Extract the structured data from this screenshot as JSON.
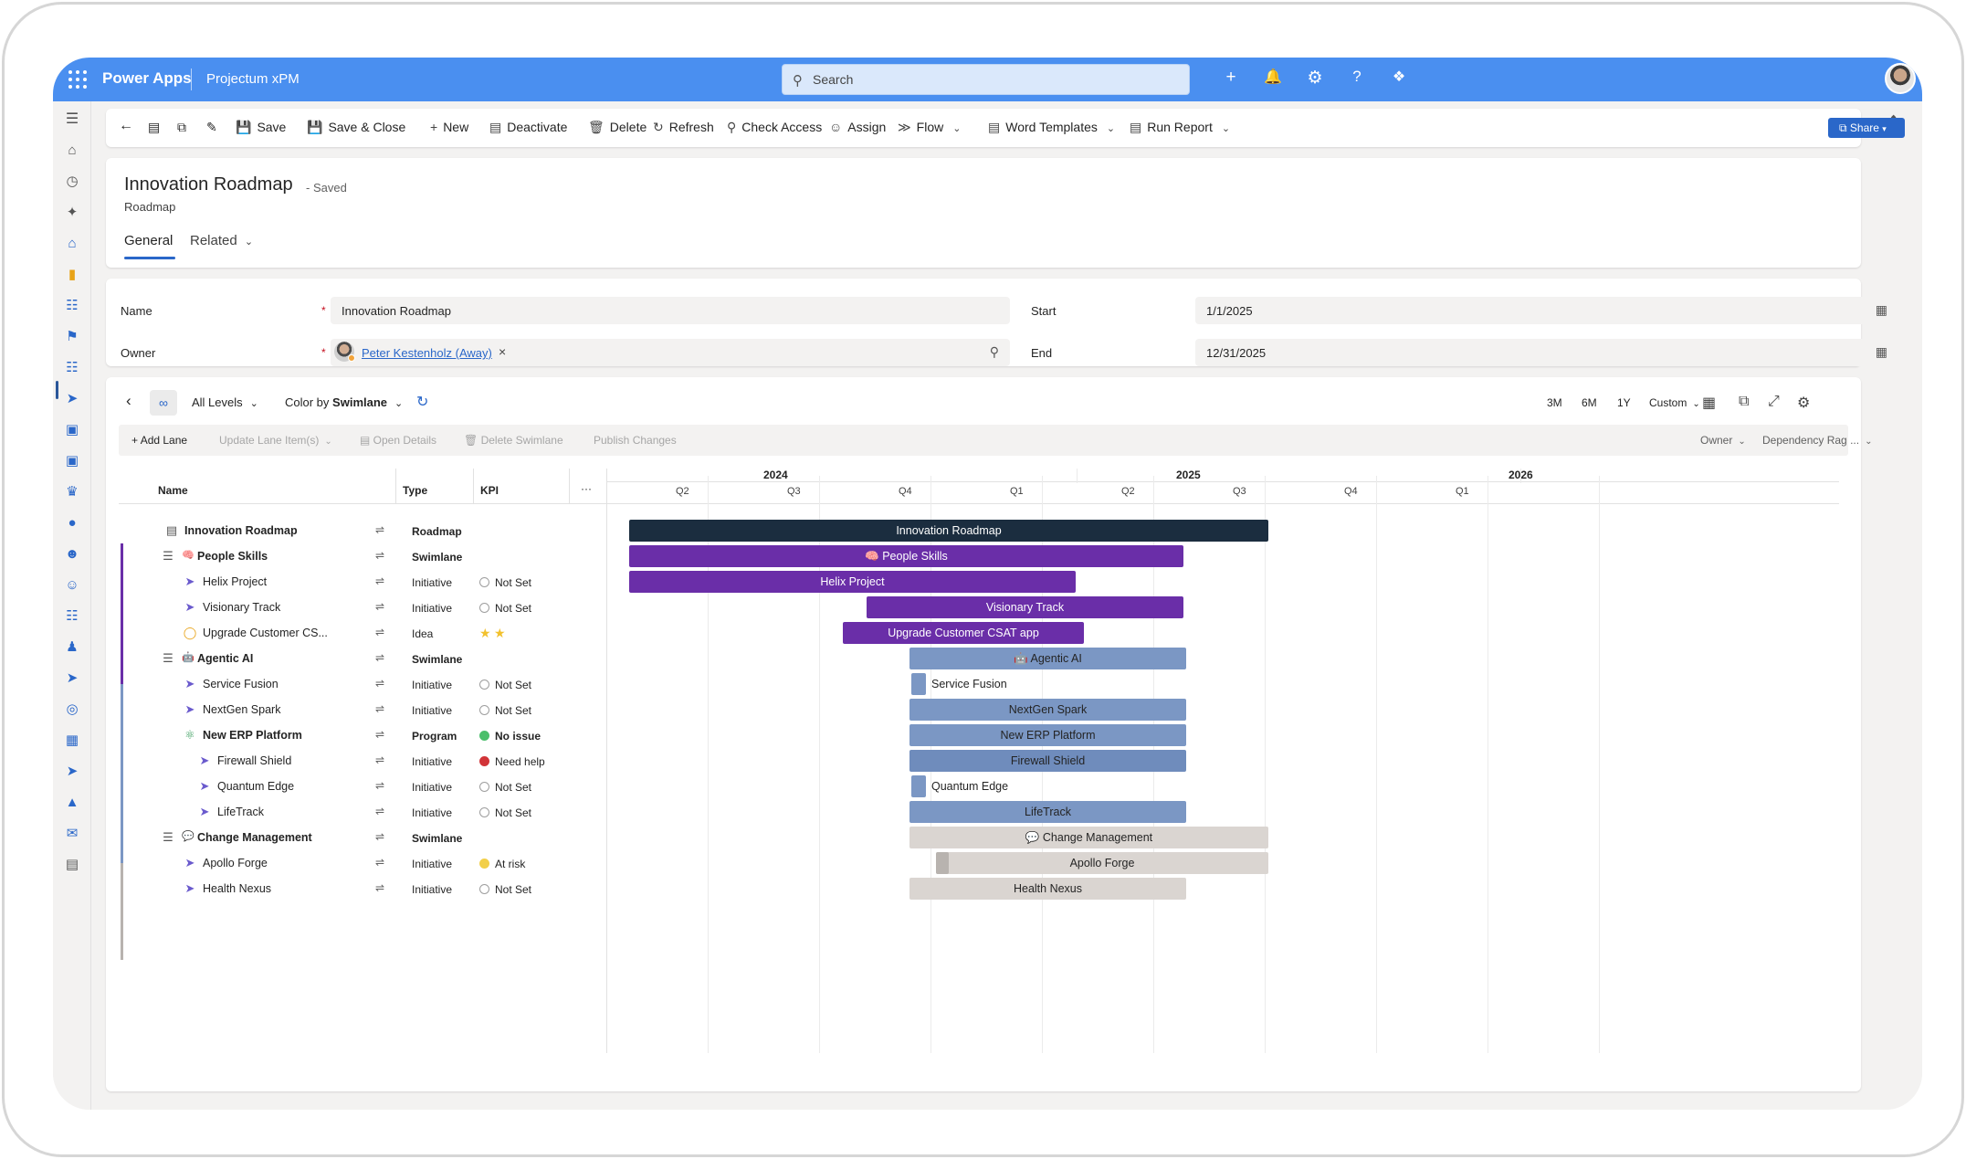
{
  "topbar": {
    "app_name": "Power Apps",
    "env_name": "Projectum xPM",
    "search_placeholder": "Search",
    "icons": [
      "add-icon",
      "bell-icon",
      "gear-icon",
      "help-icon",
      "copilot-icon"
    ]
  },
  "commands": {
    "back": "back-icon",
    "save": "Save",
    "save_close": "Save & Close",
    "new": "New",
    "deactivate": "Deactivate",
    "delete": "Delete",
    "refresh": "Refresh",
    "check_access": "Check Access",
    "assign": "Assign",
    "flow": "Flow",
    "word_templates": "Word Templates",
    "run_report": "Run Report",
    "share": "Share"
  },
  "record": {
    "title": "Innovation Roadmap",
    "status": "- Saved",
    "entity": "Roadmap",
    "tabs": [
      "General",
      "Related"
    ]
  },
  "form": {
    "name_label": "Name",
    "name_value": "Innovation Roadmap",
    "owner_label": "Owner",
    "owner_value": "Peter Kestenholz (Away)",
    "start_label": "Start",
    "start_value": "1/1/2025",
    "end_label": "End",
    "end_value": "12/31/2025"
  },
  "roadmap": {
    "levels": "All Levels",
    "color_by_prefix": "Color by",
    "color_by_value": "Swimlane",
    "ranges": [
      "3M",
      "6M",
      "1Y",
      "Custom"
    ],
    "actions": {
      "add_lane": "Add Lane",
      "update_lane": "Update Lane Item(s)",
      "open_details": "Open Details",
      "delete_swimlane": "Delete Swimlane",
      "publish": "Publish Changes",
      "owner_filter": "Owner",
      "dependency_filter": "Dependency Rag ..."
    },
    "columns": {
      "name": "Name",
      "type": "Type",
      "kpi": "KPI",
      "more": "···"
    },
    "years": [
      "2024",
      "2025",
      "2026"
    ],
    "quarters": [
      "Q2",
      "Q3",
      "Q4",
      "Q1",
      "Q2",
      "Q3",
      "Q4",
      "Q1"
    ],
    "rows": [
      {
        "name": "Innovation Roadmap",
        "type": "Roadmap",
        "kpi": "",
        "bar": "Innovation Roadmap"
      },
      {
        "name": "People Skills",
        "type": "Swimlane",
        "kpi": "",
        "bar": "People Skills"
      },
      {
        "name": "Helix Project",
        "type": "Initiative",
        "kpi": "Not Set",
        "bar": "Helix Project"
      },
      {
        "name": "Visionary Track",
        "type": "Initiative",
        "kpi": "Not Set",
        "bar": "Visionary Track"
      },
      {
        "name": "Upgrade Customer CS...",
        "type": "Idea",
        "kpi": "",
        "bar": "Upgrade Customer CSAT app"
      },
      {
        "name": "Agentic AI",
        "type": "Swimlane",
        "kpi": "",
        "bar": "Agentic AI"
      },
      {
        "name": "Service Fusion",
        "type": "Initiative",
        "kpi": "Not Set",
        "bar": "Service Fusion"
      },
      {
        "name": "NextGen Spark",
        "type": "Initiative",
        "kpi": "Not Set",
        "bar": "NextGen Spark"
      },
      {
        "name": "New ERP Platform",
        "type": "Program",
        "kpi": "No issue",
        "bar": "New ERP Platform"
      },
      {
        "name": "Firewall Shield",
        "type": "Initiative",
        "kpi": "Need help",
        "bar": "Firewall Shield"
      },
      {
        "name": "Quantum Edge",
        "type": "Initiative",
        "kpi": "Not Set",
        "bar": "Quantum Edge"
      },
      {
        "name": "LifeTrack",
        "type": "Initiative",
        "kpi": "Not Set",
        "bar": "LifeTrack"
      },
      {
        "name": "Change Management",
        "type": "Swimlane",
        "kpi": "",
        "bar": "Change Management"
      },
      {
        "name": "Apollo Forge",
        "type": "Initiative",
        "kpi": "At risk",
        "bar": "Apollo Forge"
      },
      {
        "name": "Health Nexus",
        "type": "Initiative",
        "kpi": "Not Set",
        "bar": "Health Nexus"
      }
    ],
    "colors": {
      "roadmap": "#1b2d3f",
      "people_skills": "#6a2ea8",
      "agentic_ai": "#7b97c4",
      "change_mgmt": "#dad5d1",
      "kpi_green": "#4bbf6b",
      "kpi_red": "#d13438",
      "kpi_yellow": "#f2cf49"
    }
  }
}
